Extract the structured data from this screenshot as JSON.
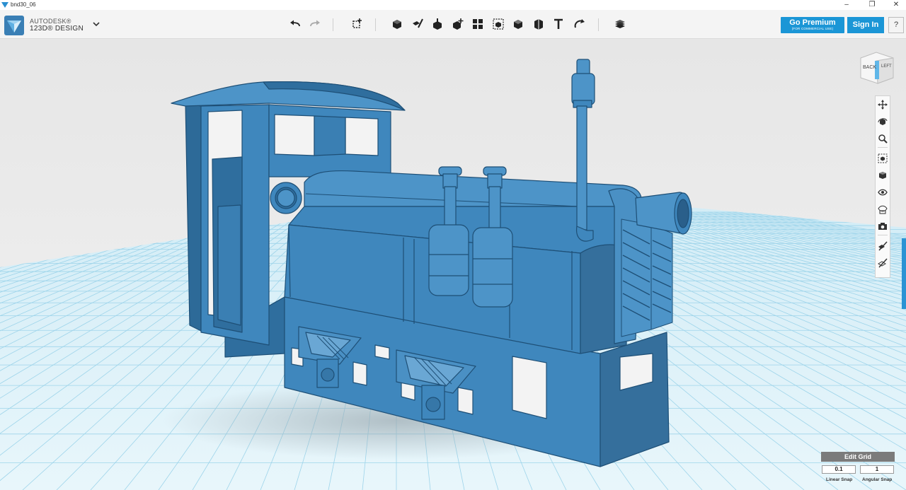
{
  "window": {
    "title": "bnd30_06",
    "minimize": "–",
    "restore": "❐",
    "close": "✕"
  },
  "brand": {
    "company": "AUTODESK®",
    "product": "123D® DESIGN"
  },
  "toolbar": {
    "tools": [
      {
        "id": "undo",
        "icon": "undo-icon"
      },
      {
        "id": "redo",
        "icon": "redo-icon"
      },
      {
        "id": "transform",
        "icon": "transform-icon"
      },
      {
        "id": "primitives",
        "icon": "primitives-icon"
      },
      {
        "id": "sketch",
        "icon": "sketch-icon"
      },
      {
        "id": "construct",
        "icon": "construct-icon"
      },
      {
        "id": "modify",
        "icon": "modify-icon"
      },
      {
        "id": "pattern",
        "icon": "pattern-icon"
      },
      {
        "id": "grouping",
        "icon": "grouping-icon"
      },
      {
        "id": "combine",
        "icon": "combine-icon"
      },
      {
        "id": "measure",
        "icon": "measure-icon"
      },
      {
        "id": "text",
        "icon": "text-icon"
      },
      {
        "id": "snap",
        "icon": "snap-icon"
      },
      {
        "id": "material",
        "icon": "material-icon"
      }
    ]
  },
  "premium": {
    "label": "Go Premium",
    "sublabel": "(FOR COMMERCIAL USE)"
  },
  "signin": {
    "label": "Sign In"
  },
  "help": {
    "label": "?"
  },
  "viewcube": {
    "back": "BACK",
    "left": "LEFT"
  },
  "navbar": {
    "items": [
      "pan-icon",
      "orbit-icon",
      "zoom-icon",
      "fit-icon",
      "perspective-icon",
      "visibility-icon",
      "materials-outline-icon",
      "screenshot-icon",
      "hide-sketch-icon",
      "hide-mesh-icon"
    ]
  },
  "grid": {
    "edit_label": "Edit Grid",
    "linear_value": "0.1",
    "angular_value": "1",
    "linear_label": "Linear Snap",
    "angular_label": "Angular Snap"
  },
  "colors": {
    "accent": "#1b96d6",
    "model": "#3f87bd",
    "model_dark": "#22557d",
    "grid_line": "#8fd0ea"
  }
}
